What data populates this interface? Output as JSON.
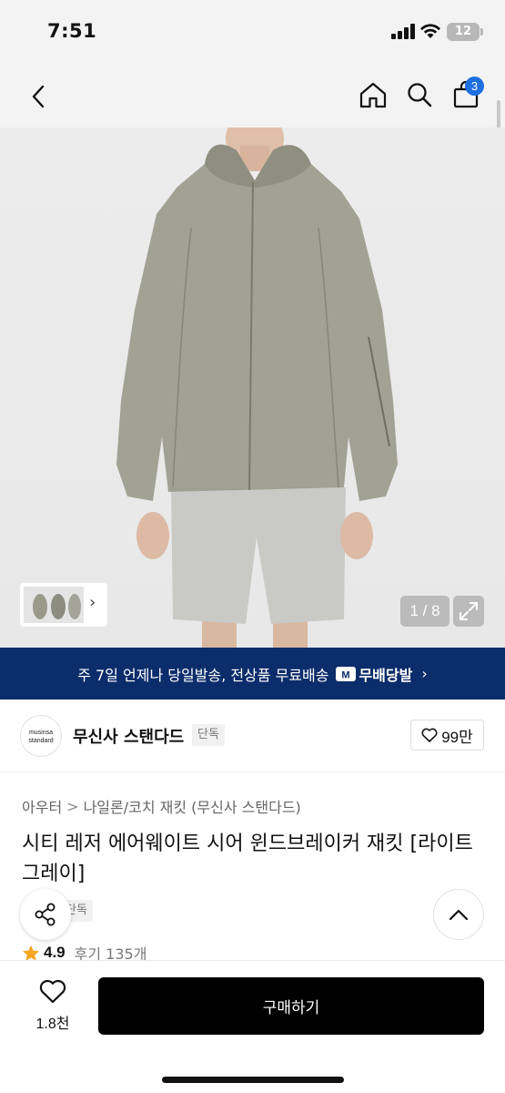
{
  "status_bar": {
    "time": "7:51",
    "battery": "12"
  },
  "header": {
    "cart_count": "3"
  },
  "gallery": {
    "page_indicator": "1 / 8"
  },
  "banner": {
    "text": "주 7일 언제나 당일발송, 전상품 무료배송",
    "badge": "무배당발",
    "chevron": "›"
  },
  "brand": {
    "logo_text_1": "musinsa",
    "logo_text_2": "standard",
    "name": "무신사 스탠다드",
    "tag": "단독",
    "likes": "99만"
  },
  "breadcrumb": {
    "items": [
      "아우터",
      "나일론/코치 재킷 (무신사 스탠다드)"
    ],
    "separator": ">"
  },
  "product": {
    "title": "시티 레저 에어웨이트 시어 윈드브레이커 재킷 [라이트 그레이]",
    "exclusive_tag": "단독",
    "rating": "4.9",
    "reviews": "후기 135개"
  },
  "bottom_bar": {
    "wish_count": "1.8천",
    "buy_label": "구매하기"
  },
  "colors": {
    "banner_bg": "#0c2d6b",
    "badge_blue": "#1e6fe0",
    "star": "#f5a623",
    "jacket": "#9a9a8c"
  }
}
